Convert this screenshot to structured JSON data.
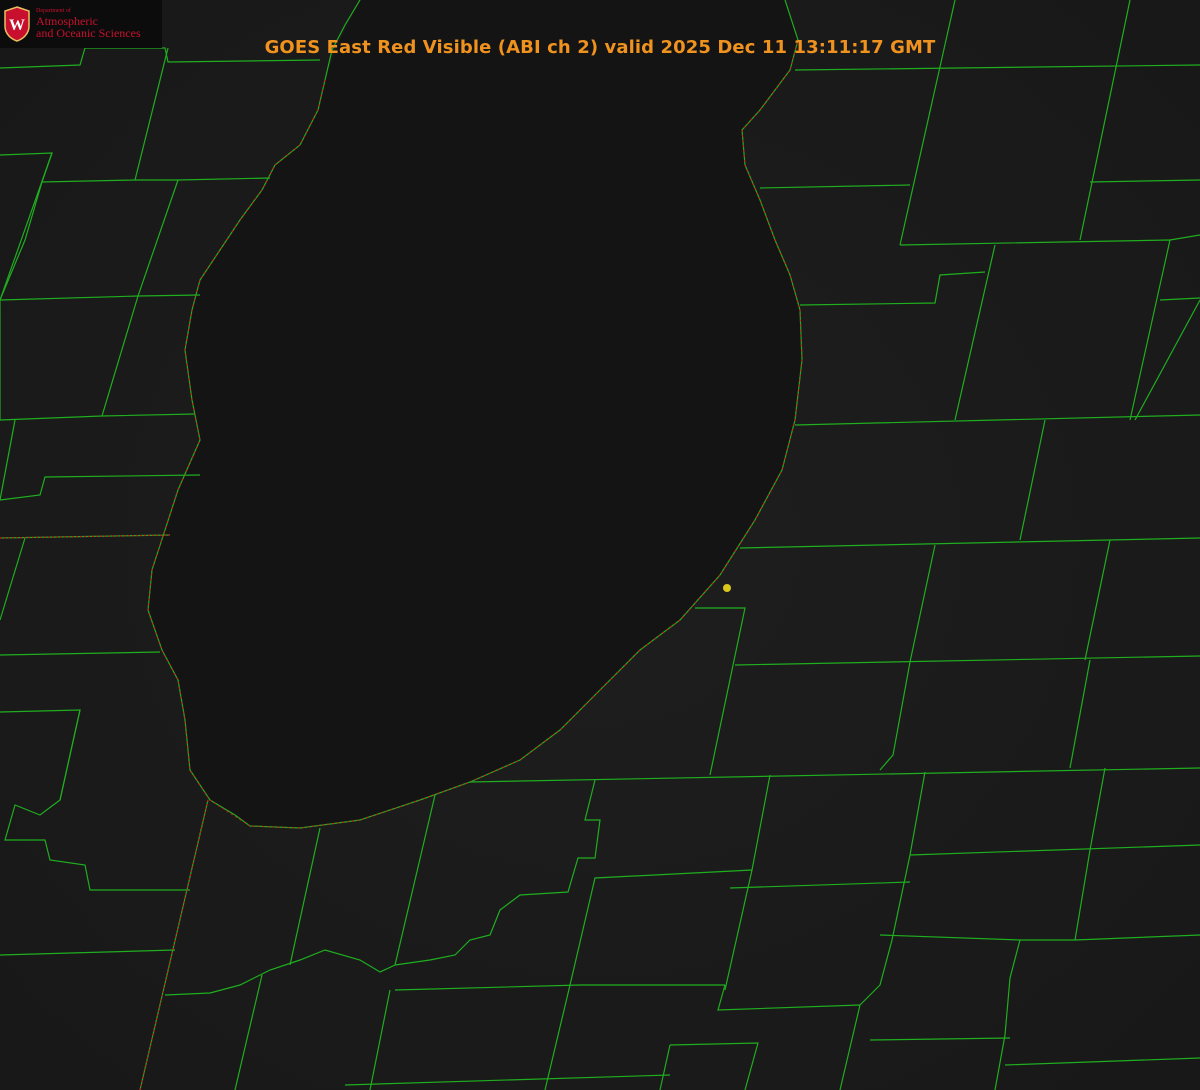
{
  "header": {
    "title": "GOES East Red Visible (ABI ch 2) valid 2025 Dec 11 13:11:17 GMT"
  },
  "logo": {
    "dept": "Department of",
    "line1": "Atmospheric",
    "line2": "and Oceanic Sciences",
    "shield_letter": "W",
    "icon": "uw-crest-icon"
  },
  "map": {
    "layers": [
      "county-boundaries",
      "state-boundaries",
      "lake-shoreline",
      "station-marker"
    ],
    "colors": {
      "county": "#1fae1f",
      "state": "#c02020",
      "title": "#f0921e",
      "marker": "#d8c81c",
      "background": "#1c1c1c"
    }
  }
}
